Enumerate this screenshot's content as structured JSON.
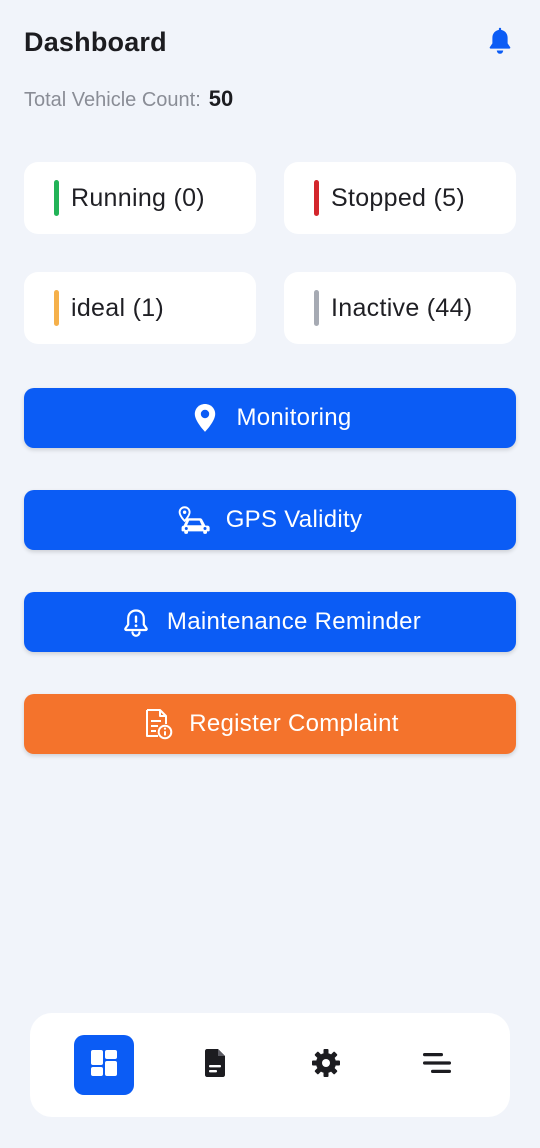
{
  "header": {
    "title": "Dashboard",
    "notification_icon": "bell-icon"
  },
  "summary": {
    "label": "Total Vehicle Count:",
    "value": "50"
  },
  "statuses": [
    {
      "label": "Running (0)",
      "color": "#22b357"
    },
    {
      "label": "Stopped (5)",
      "color": "#d3262c"
    },
    {
      "label": "ideal (1)",
      "color": "#f5b04a"
    },
    {
      "label": "Inactive (44)",
      "color": "#a6aab3"
    }
  ],
  "actions": [
    {
      "label": "Monitoring",
      "icon": "map-pin-icon",
      "color": "#0b5cf5"
    },
    {
      "label": "GPS Validity",
      "icon": "car-location-icon",
      "color": "#0b5cf5"
    },
    {
      "label": "Maintenance Reminder",
      "icon": "alert-bell-icon",
      "color": "#0b5cf5"
    },
    {
      "label": "Register Complaint",
      "icon": "document-info-icon",
      "color": "#f4732c"
    }
  ],
  "bottom_nav": {
    "items": [
      {
        "icon": "dashboard-grid-icon",
        "active": true
      },
      {
        "icon": "document-icon",
        "active": false
      },
      {
        "icon": "gear-icon",
        "active": false
      },
      {
        "icon": "menu-lines-icon",
        "active": false
      }
    ]
  }
}
